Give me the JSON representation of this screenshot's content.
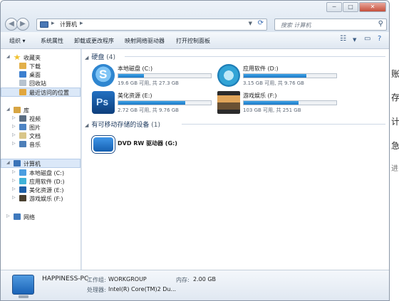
{
  "window": {
    "address_path": "计算机",
    "search_placeholder": "搜索 计算机"
  },
  "toolbar": {
    "items": [
      "组织 ▾",
      "系统属性",
      "卸载或更改程序",
      "映射网络驱动器",
      "打开控制面板"
    ]
  },
  "sidebar": {
    "favorites_label": "收藏夹",
    "favorites": [
      "下载",
      "桌面",
      "回收站",
      "最近访问的位置"
    ],
    "library_label": "库",
    "libraries": [
      "视频",
      "图片",
      "文档",
      "音乐"
    ],
    "computer_label": "计算机",
    "computer_items": [
      "本地磁盘 (C:)",
      "应用软件 (D:)",
      "美化资源 (E:)",
      "游戏娱乐 (F:)"
    ],
    "network_label": "网络"
  },
  "content": {
    "hard_disks_header": "硬盘",
    "hard_disks_count": "(4)",
    "drives": [
      {
        "name": "本地磁盘 (C:)",
        "size": "19.6 GB 可用, 共 27.3 GB",
        "used_fraction": 0.28,
        "color": "#4a9de0"
      },
      {
        "name": "应用软件 (D:)",
        "size": "3.15 GB 可用, 共 9.76 GB",
        "used_fraction": 0.68,
        "color": "#3fb2d8"
      },
      {
        "name": "美化资源 (E:)",
        "size": "2.72 GB 可用, 共 9.76 GB",
        "used_fraction": 0.72,
        "color": "#1d5fa8"
      },
      {
        "name": "游戏娱乐 (F:)",
        "size": "103 GB 可用, 共 251 GB",
        "used_fraction": 0.59,
        "color": "#4a4030"
      }
    ],
    "removable_header": "有可移动存储的设备",
    "removable_count": "(1)",
    "dvd_name": "DVD RW 驱动器 (G:)",
    "icon_labels": {
      "skype": "S",
      "ps": "Ps"
    }
  },
  "details": {
    "pc_name": "HAPPINESS-PC",
    "workgroup_label": "工作组:",
    "workgroup_value": "WORKGROUP",
    "memory_label": "内存:",
    "memory_value": "2.00 GB",
    "processor_label": "处理器:",
    "processor_value": "Intel(R) Core(TM)2 Du..."
  },
  "background_text": [
    "账",
    "存",
    "计",
    "急",
    "进"
  ]
}
